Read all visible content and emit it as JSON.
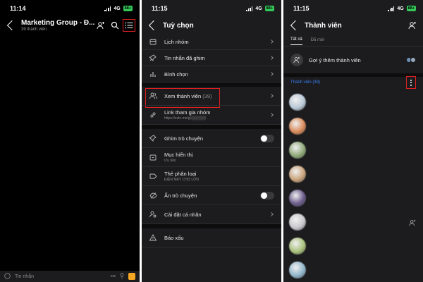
{
  "panel1": {
    "status": {
      "time": "11:14",
      "network": "4G",
      "battery": "88+"
    },
    "header": {
      "title": "Marketing Group - Đ...",
      "subtitle": "39 thành viên"
    },
    "icons": [
      "back-icon",
      "add-member-icon",
      "search-icon",
      "menu-list-icon"
    ],
    "bottom": {
      "placeholder": "Tin nhắn",
      "more": "•••"
    }
  },
  "panel2": {
    "status": {
      "time": "11:15",
      "network": "4G",
      "battery": "88+"
    },
    "header": {
      "title": "Tuỳ chọn"
    },
    "groups": [
      {
        "rows": [
          {
            "label": "Lịch nhóm",
            "icon": "calendar-icon"
          },
          {
            "label": "Tin nhắn đã ghim",
            "icon": "pin-icon"
          },
          {
            "label": "Bình chọn",
            "icon": "poll-icon"
          }
        ]
      },
      {
        "rows": [
          {
            "label": "Xem thành viên",
            "count": "(39)",
            "icon": "members-icon"
          },
          {
            "label": "Link tham gia nhóm",
            "sub": "https://zalo.me/g/▒▒▒▒▒▒",
            "icon": "link-icon"
          }
        ]
      },
      {
        "rows": [
          {
            "label": "Ghim trò chuyện",
            "icon": "pin-chat-icon",
            "toggle": true
          },
          {
            "label": "Mục hiển thị",
            "sub": "Ưu tiên",
            "icon": "folder-icon"
          },
          {
            "label": "Thẻ phân loại",
            "sub": "ĐIỆN MÁY CHỢ LỚN",
            "icon": "tag-icon"
          },
          {
            "label": "Ẩn trò chuyện",
            "icon": "hide-icon",
            "toggle": true
          },
          {
            "label": "Cài đặt cá nhân",
            "icon": "personal-settings-icon"
          }
        ]
      },
      {
        "rows": [
          {
            "label": "Báo xấu",
            "icon": "report-icon"
          }
        ]
      }
    ]
  },
  "panel3": {
    "status": {
      "time": "11:15",
      "network": "4G",
      "battery": "88+"
    },
    "header": {
      "title": "Thành viên"
    },
    "tabs": [
      {
        "label": "Tất cả",
        "active": true
      },
      {
        "label": "Đã mời",
        "active": false
      }
    ],
    "suggest": {
      "label": "Gợi ý thêm thành viên"
    },
    "members_header": {
      "label": "Thành viên (39)"
    },
    "avatar_colors": [
      "#b9c7d6",
      "#d98a5a",
      "#8fa878",
      "#c9a37a",
      "#6a5a8a",
      "#c8c8cc",
      "#a9c07a",
      "#8fb5c9"
    ]
  },
  "colors": {
    "highlight": "#e02020",
    "accent_blue": "#3b82f6",
    "toggle_off": "#3a3a3c"
  }
}
